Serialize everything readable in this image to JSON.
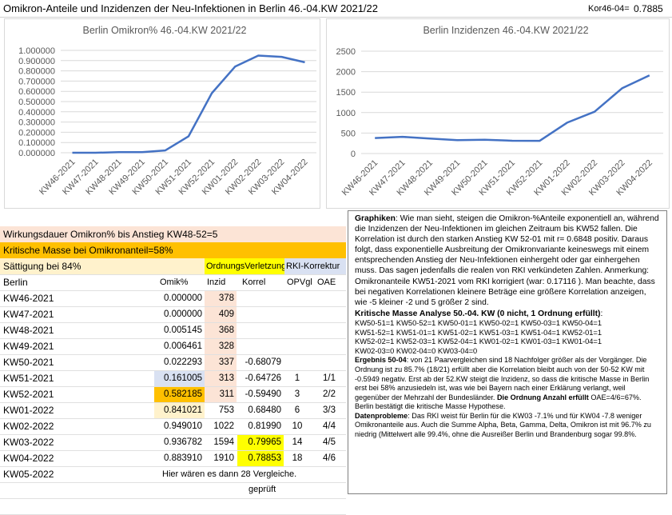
{
  "header": {
    "title": "Omikron-Anteile und Inzidenzen der Neu-Infektionen in Berlin 46.-04.KW 2021/22",
    "kor_label": "Kor46-04=",
    "kor_value": "0.7885"
  },
  "chart_data": [
    {
      "type": "line",
      "title": "Berlin Omikron%  46.-04.KW 2021/22",
      "categories": [
        "KW46-2021",
        "KW47-2021",
        "KW48-2021",
        "KW49-2021",
        "KW50-2021",
        "KW51-2021",
        "KW52-2021",
        "KW01-2022",
        "KW02-2022",
        "KW03-2022",
        "KW04-2022"
      ],
      "values": [
        0.0,
        0.0,
        0.005145,
        0.006461,
        0.022293,
        0.161005,
        0.582185,
        0.841021,
        0.94901,
        0.936782,
        0.88391
      ],
      "yticks": [
        "1.000000",
        "0.900000",
        "0.800000",
        "0.700000",
        "0.600000",
        "0.500000",
        "0.400000",
        "0.300000",
        "0.200000",
        "0.100000",
        "0.000000"
      ],
      "ylim": [
        0,
        1
      ],
      "grid": true,
      "color": "#4472c4"
    },
    {
      "type": "line",
      "title": "Berlin Inzidenzen 46.-04.KW 2021/22",
      "categories": [
        "KW46-2021",
        "KW47-2021",
        "KW48-2021",
        "KW49-2021",
        "KW50-2021",
        "KW51-2021",
        "KW52-2021",
        "KW01-2022",
        "KW02-2022",
        "KW03-2022",
        "KW04-2022"
      ],
      "values": [
        378,
        409,
        368,
        328,
        337,
        313,
        311,
        753,
        1022,
        1594,
        1910
      ],
      "yticks": [
        "2500",
        "2000",
        "1500",
        "1000",
        "500",
        "0"
      ],
      "ylim": [
        0,
        2500
      ],
      "grid": true,
      "color": "#4472c4"
    }
  ],
  "table": {
    "banner1": "Wirkungsdauer Omikron% bis Anstieg KW48-52=5",
    "banner2": "Kritische Masse bei Omikronanteil=58%",
    "banner3": "Sättigung bei 84%",
    "ordnungs": "OrdnungsVerletzung",
    "rki": "RKI-Korrektur",
    "headers": {
      "berlin": "Berlin",
      "omik": "Omik%",
      "inzid": "Inzid",
      "korrel": "Korrel",
      "opvgl": "OPVgl",
      "oae": "OAE"
    },
    "rows": [
      {
        "kw": "KW46-2021",
        "omik": "0.000000",
        "inzid": "378",
        "korrel": "",
        "opvgl": "",
        "oae": ""
      },
      {
        "kw": "KW47-2021",
        "omik": "0.000000",
        "inzid": "409",
        "korrel": "",
        "opvgl": "",
        "oae": ""
      },
      {
        "kw": "KW48-2021",
        "omik": "0.005145",
        "inzid": "368",
        "korrel": "",
        "opvgl": "",
        "oae": ""
      },
      {
        "kw": "KW49-2021",
        "omik": "0.006461",
        "inzid": "328",
        "korrel": "",
        "opvgl": "",
        "oae": ""
      },
      {
        "kw": "KW50-2021",
        "omik": "0.022293",
        "inzid": "337",
        "korrel": "-0.68079",
        "opvgl": "",
        "oae": ""
      },
      {
        "kw": "KW51-2021",
        "omik": "0.161005",
        "inzid": "313",
        "korrel": "-0.64726",
        "opvgl": "1",
        "oae": "1/1"
      },
      {
        "kw": "KW52-2021",
        "omik": "0.582185",
        "inzid": "311",
        "korrel": "-0.59490",
        "opvgl": "3",
        "oae": "2/2"
      },
      {
        "kw": "KW01-2022",
        "omik": "0.841021",
        "inzid": "753",
        "korrel": "0.68480",
        "opvgl": "6",
        "oae": "3/3"
      },
      {
        "kw": "KW02-2022",
        "omik": "0.949010",
        "inzid": "1022",
        "korrel": "0.81990",
        "opvgl": "10",
        "oae": "4/4"
      },
      {
        "kw": "KW03-2022",
        "omik": "0.936782",
        "inzid": "1594",
        "korrel": "0.79965",
        "opvgl": "14",
        "oae": "4/5"
      },
      {
        "kw": "KW04-2022",
        "omik": "0.883910",
        "inzid": "1910",
        "korrel": "0.78853",
        "opvgl": "18",
        "oae": "4/6"
      },
      {
        "kw": "KW05-2022",
        "omik": "",
        "inzid": "",
        "korrel": "",
        "opvgl": "",
        "oae": ""
      }
    ],
    "note": "Hier wären es dann 28 Vergleiche.",
    "geprueft": "geprüft"
  },
  "textbox": {
    "p1_bold": "Graphiken",
    "p1": ": Wie man sieht, steigen die Omikron-%Anteile exponentiell an, während die Inzidenzen der Neu-Infektionen im gleichen Zeitraum bis KW52 fallen. Die Korrelation ist durch den starken Anstieg  KW 52-01 mit r= 0.6848 positiv. Daraus folgt, dass exponentielle Ausbreitung der Omikronvariante keineswegs mit einem entsprechenden Anstieg der Neu-Infektionen einhergeht oder gar einhergehen muss. Das sagen jedenfalls die realen von RKI verkündeten Zahlen.  Anmerkung: Omikronanteile KW51-2021 vom RKI korrigiert (war: 0.17116 ). Man beachte, dass bei negativen Korrelationen kleinere Beträge eine größere Korrelation anzeigen, wie -5 kleiner -2 und 5 größer 2 sind.",
    "krit_title": "Kritische Masse Analyse 50.-04. KW  (0 nicht, 1 Ordnung erfüllt)",
    "krit_colon": ":",
    "krit_lines": [
      "KW50-51=1  KW50-52=1  KW50-01=1  KW50-02=1  KW50-03=1  KW50-04=1",
      "KW51-52=1  KW51-01=1  KW51-02=1  KW51-03=1  KW51-04=1  KW52-01=1",
      "KW52-02=1  KW52-03=1  KW52-04=1  KW01-02=1  KW01-03=1  KW01-04=1",
      "KW02-03=0  KW02-04=0  KW03-04=0"
    ],
    "erg_bold": "Ergebnis 50-04",
    "erg_text": ": von 21 Paarvergleichen sind 18 Nachfolger größer als der Vorgänger. Die Ordnung ist zu 85.7% (18/21) erfüllt aber die Korrelation bleibt auch von der 50-52 KW mit -0.5949 negativ.  Erst ab der 52.KW steigt die Inzidenz, so dass die kritische Masse in Berlin  erst bei 58% anzusiedeln ist, was wie bei Bayern nach einer Erklärung verlangt, weil  gegenüber der Mehrzahl der Bundesländer. ",
    "erg_bold2": "Die Ordnung Anzahl erfüllt",
    "erg_text2": " OAE=4/6=67%. Berlin bestätigt die kritische Masse Hypothese.",
    "dat_bold": "Datenprobleme",
    "dat_text": ": Das RKI weist für Berlin für die KW03 -7.1% und für KW04 -7.8 weniger Omikronanteile aus. Auch die Summe Alpha, Beta, Gamma, Delta, Omikron ist mit 96.7% zu niedrig (Mittelwert alle 99.4%, ohne die Ausreißer Berlin und Brandenburg sogar 99.8%."
  },
  "colors": {
    "line": "#4472c4",
    "banner_peach": "#fce4d6",
    "banner_orange": "#ffc000",
    "banner_light": "#fff2cc",
    "yellow": "#ffff00",
    "lavender": "#d9e1f2",
    "inzid_bg": "#fce4d6"
  }
}
